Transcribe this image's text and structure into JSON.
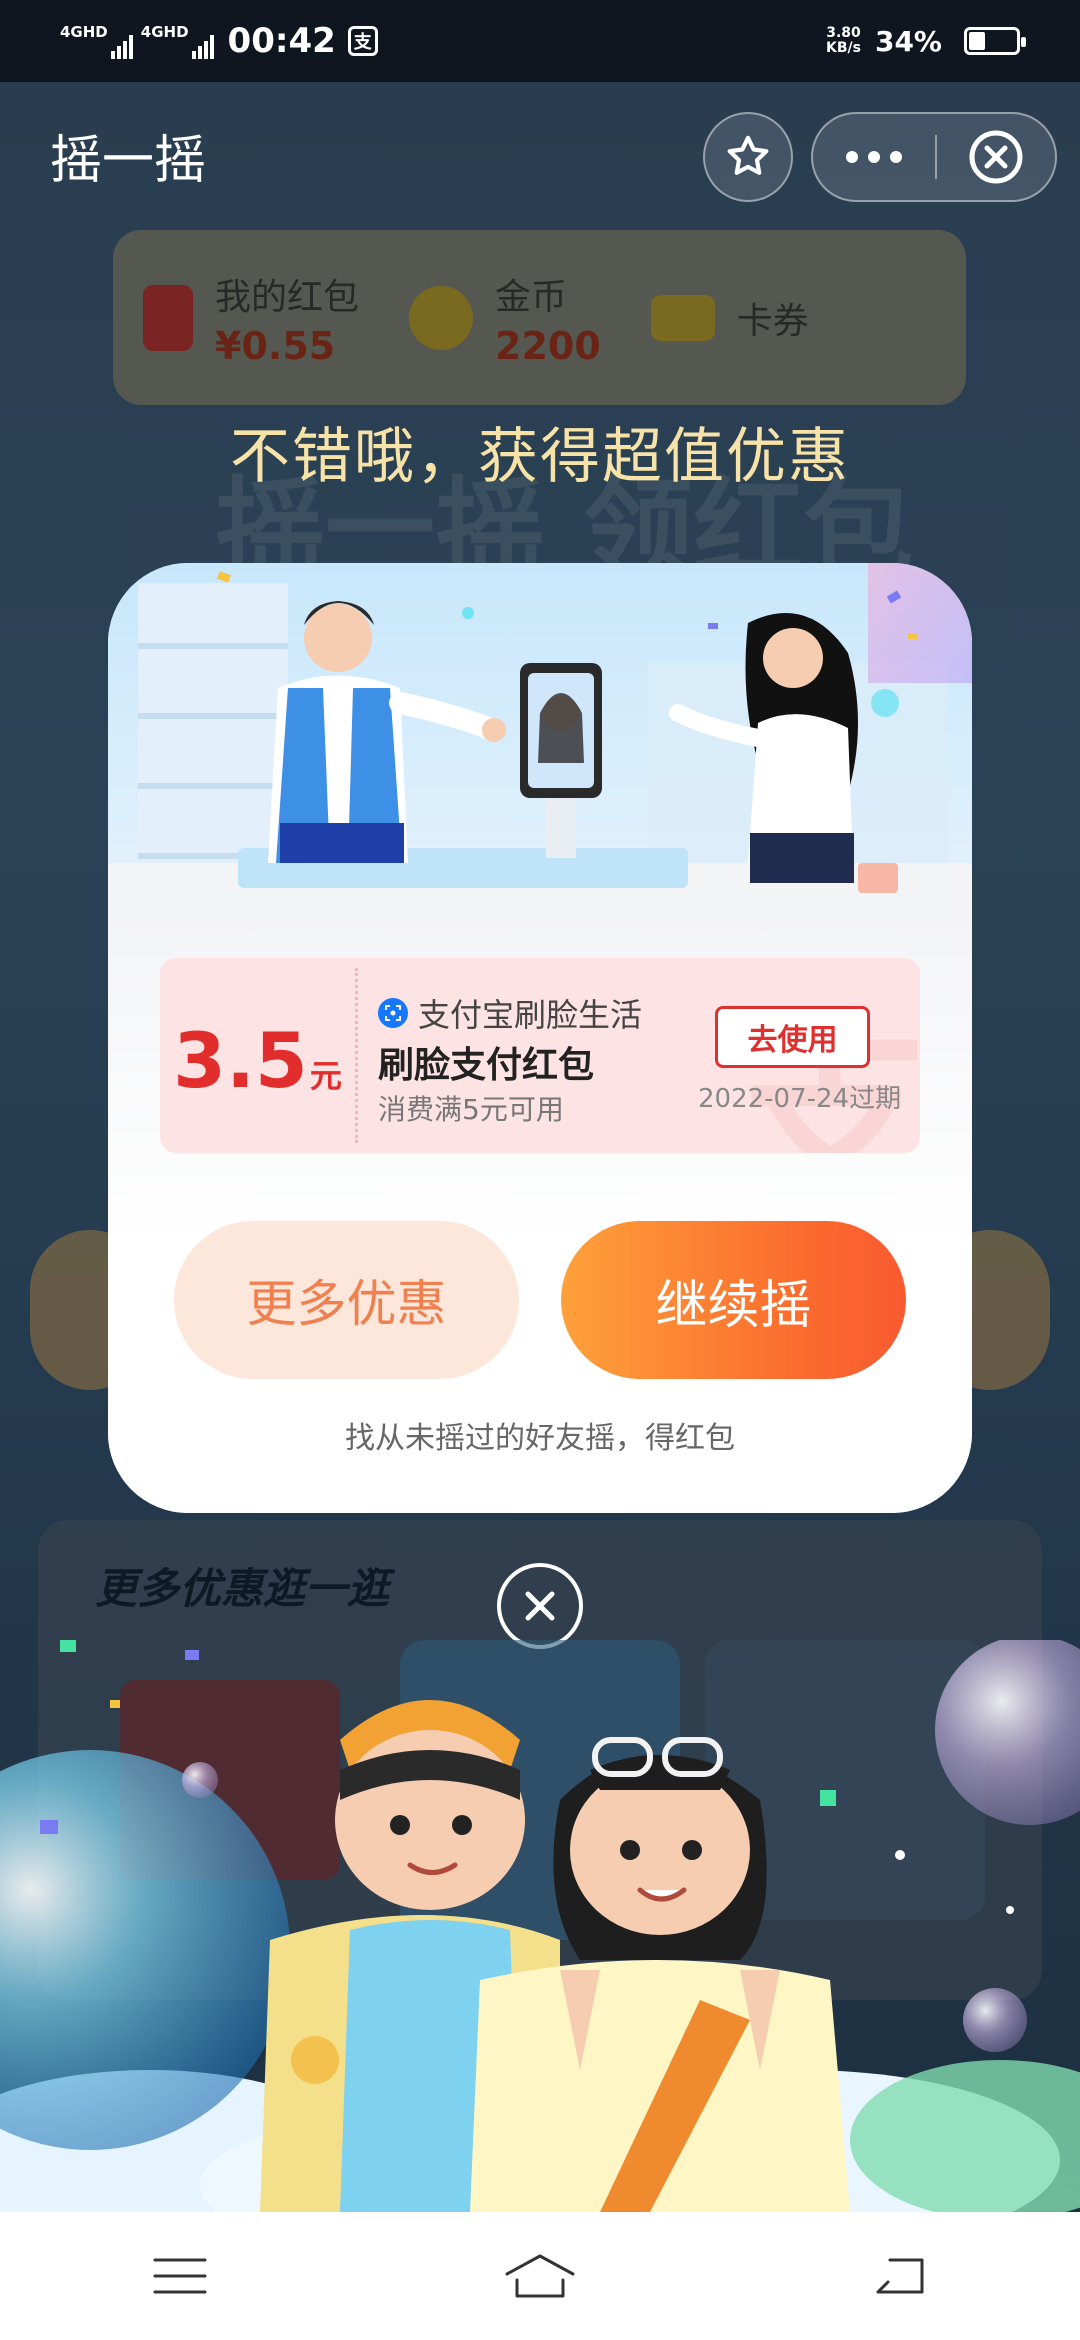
{
  "status_bar": {
    "signal1_label": "4GHD",
    "signal2_label": "4GHD",
    "time": "00:42",
    "pay_icon": "支",
    "net_speed_value": "3.80",
    "net_speed_unit": "KB/s",
    "battery": "34%"
  },
  "header": {
    "title": "摇一摇"
  },
  "wallet": {
    "red_packet_label": "我的红包",
    "red_packet_value": "¥0.55",
    "coins_label": "金币",
    "coins_value": "2200",
    "coupons_label": "卡券"
  },
  "background": {
    "banner_text": "摇一摇 领红包",
    "section_title": "更多优惠逛一逛"
  },
  "popup": {
    "headline": "不错哦，获得超值优惠",
    "coupon": {
      "amount": "3.5",
      "unit": "元",
      "brand": "支付宝刷脸生活",
      "title": "刷脸支付红包",
      "condition": "消费满5元可用",
      "use_label": "去使用",
      "expiry": "2022-07-24过期"
    },
    "more_label": "更多优惠",
    "continue_label": "继续摇",
    "hint": "找从未摇过的好友摇，得红包"
  },
  "icons": {
    "favorite": "star-icon",
    "more": "more-dots-icon",
    "close": "close-circle-icon",
    "nav_menu": "menu-icon",
    "nav_home": "home-icon",
    "nav_back": "back-icon"
  },
  "colors": {
    "accent_red": "#e22d2d",
    "continue_orange": "#fb6b2e",
    "more_peach": "#fde6da",
    "headline_gold": "#f7e2a8"
  }
}
